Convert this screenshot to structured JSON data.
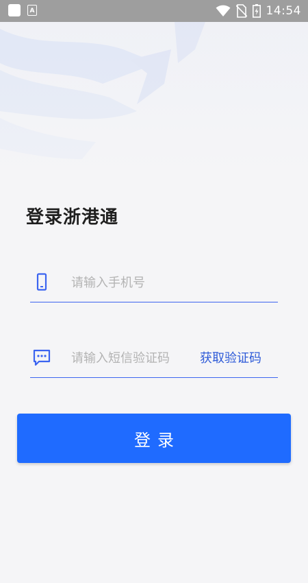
{
  "status_bar": {
    "time": "14:54",
    "icons": [
      "app-square-icon",
      "font-a-icon",
      "wifi-icon",
      "no-sim-icon",
      "battery-icon"
    ]
  },
  "header": {
    "title": "登录浙港通"
  },
  "form": {
    "phone": {
      "placeholder": "请输入手机号",
      "icon": "phone-icon"
    },
    "code": {
      "placeholder": "请输入短信验证码",
      "icon": "message-icon",
      "get_code_label": "获取验证码"
    }
  },
  "login_button": {
    "label": "登录"
  },
  "colors": {
    "accent": "#1f6bff",
    "link": "#2e5bd8",
    "underline": "#3b64f0",
    "status_bar": "#9e9e9e",
    "background": "#f5f5f7"
  }
}
